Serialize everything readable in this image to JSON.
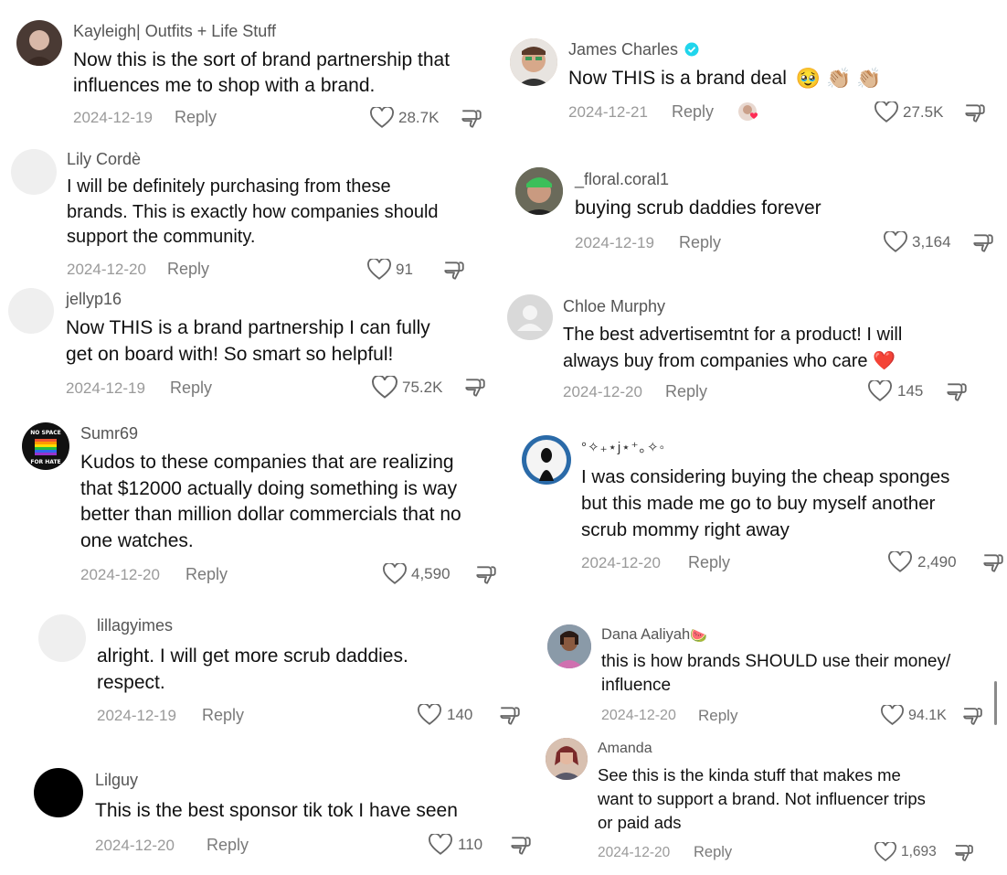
{
  "comments": [
    {
      "username": "Kayleigh| Outfits + Life Stuff",
      "lines": [
        "Now this is the sort of brand partnership that",
        "influences me to shop with a brand."
      ],
      "date": "2024-12-19",
      "reply": "Reply",
      "likes": "28.7K",
      "avatar_color": "#4a3a34"
    },
    {
      "username": "Lily Cordè",
      "lines": [
        "I will be definitely purchasing from these",
        "brands. This is exactly how companies should",
        "support the community."
      ],
      "date": "2024-12-20",
      "reply": "Reply",
      "likes": "91",
      "avatar_color": "#efefef"
    },
    {
      "username": "jellyp16",
      "lines": [
        "Now THIS is a brand partnership I can fully",
        "get on board with! So smart so helpful!"
      ],
      "date": "2024-12-19",
      "reply": "Reply",
      "likes": "75.2K",
      "avatar_color": "#efefef"
    },
    {
      "username": "Sumr69",
      "lines": [
        "Kudos to these companies that are realizing",
        "that $12000 actually doing something is way",
        "better than million dollar commercials that no",
        "one watches."
      ],
      "date": "2024-12-20",
      "reply": "Reply",
      "likes": "4,590",
      "avatar_color": "#111111",
      "avatar_text_top": "NO SPACE",
      "avatar_text_bottom": "FOR HATE"
    },
    {
      "username": "lillagyimes",
      "lines": [
        "alright. I will get more scrub daddies.",
        "respect."
      ],
      "date": "2024-12-19",
      "reply": "Reply",
      "likes": "140",
      "avatar_color": "#efefef"
    },
    {
      "username": "Lilguy",
      "lines": [
        "This is the best sponsor tik tok I have seen"
      ],
      "date": "2024-12-20",
      "reply": "Reply",
      "likes": "110",
      "avatar_color": "#000000"
    },
    {
      "username": "James Charles",
      "verified": true,
      "lines": [
        "Now THIS is a brand deal"
      ],
      "emojis": [
        "🥹",
        "👏🏼",
        "👏🏼"
      ],
      "date": "2024-12-21",
      "reply": "Reply",
      "likes": "27.5K",
      "avatar_color": "#c9a38a"
    },
    {
      "username": "_floral.coral1",
      "lines": [
        "buying scrub daddies forever"
      ],
      "date": "2024-12-19",
      "reply": "Reply",
      "likes": "3,164",
      "avatar_color": "#5a7a4a"
    },
    {
      "username": "Chloe Murphy",
      "lines": [
        "The best advertisemtnt for a product! I will",
        "always buy from companies who care"
      ],
      "emojis": [
        "❤️"
      ],
      "date": "2024-12-20",
      "reply": "Reply",
      "likes": "145",
      "avatar_color": "#d9d9d9"
    },
    {
      "username": "°✧₊⋆j⋆⁺｡✧◦",
      "lines": [
        "I was considering buying the cheap sponges",
        "but this made me go to buy myself another",
        "scrub mommy right away"
      ],
      "date": "2024-12-20",
      "reply": "Reply",
      "likes": "2,490",
      "avatar_color": "#2a6aa8"
    },
    {
      "username": "Dana Aaliyah",
      "username_emoji": "🍉",
      "lines": [
        "this is how brands SHOULD use their money/",
        "influence"
      ],
      "date": "2024-12-20",
      "reply": "Reply",
      "likes": "94.1K",
      "avatar_color": "#a08ab0"
    },
    {
      "username": "Amanda",
      "lines": [
        "See this is the kinda stuff that makes me",
        "want to support a brand. Not influencer trips",
        "or paid ads"
      ],
      "date": "2024-12-20",
      "reply": "Reply",
      "likes": "1,693",
      "avatar_color": "#9a6a60"
    }
  ]
}
